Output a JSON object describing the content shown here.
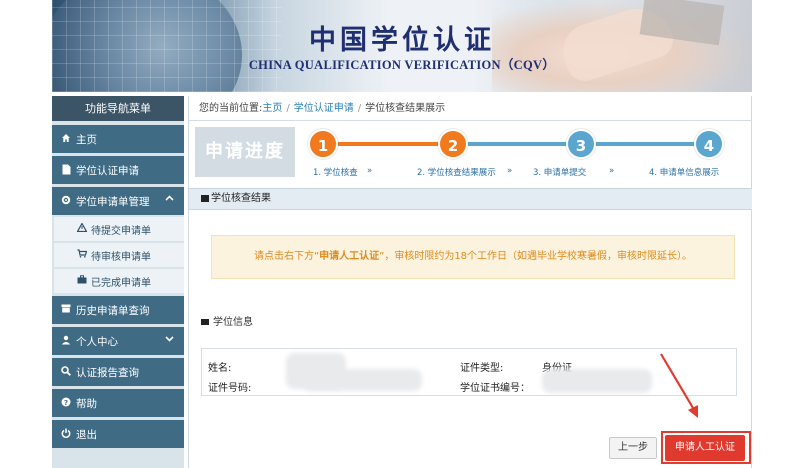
{
  "banner": {
    "title_zh": "中国学位认证",
    "title_en": "CHINA QUALIFICATION VERIFICATION（CQV）"
  },
  "sidebar": {
    "header": "功能导航菜单",
    "items": [
      {
        "label": "主页",
        "icon": "home-icon"
      },
      {
        "label": "学位认证申请",
        "icon": "document-icon"
      },
      {
        "label": "学位申请单管理",
        "icon": "gear-icon"
      },
      {
        "label": "待提交申请单",
        "icon": "warning-icon"
      },
      {
        "label": "待审核申请单",
        "icon": "cart-icon"
      },
      {
        "label": "已完成申请单",
        "icon": "briefcase-icon"
      },
      {
        "label": "历史申请单查询",
        "icon": "archive-icon"
      },
      {
        "label": "个人中心",
        "icon": "user-icon"
      },
      {
        "label": "认证报告查询",
        "icon": "search-icon"
      },
      {
        "label": "帮助",
        "icon": "help-icon"
      },
      {
        "label": "退出",
        "icon": "power-icon"
      }
    ]
  },
  "breadcrumb": {
    "prefix": "您的当前位置:",
    "home": "主页",
    "apply": "学位认证申请",
    "current": "学位核查结果展示"
  },
  "progress": {
    "title": "申请进度",
    "steps": [
      {
        "num": "1",
        "label": "1. 学位核查"
      },
      {
        "num": "2",
        "label": "2. 学位核查结果展示"
      },
      {
        "num": "3",
        "label": "3. 申请单提交"
      },
      {
        "num": "4",
        "label": "4. 申请单信息展示"
      }
    ],
    "arrow": "»",
    "colors": {
      "done": "#f07a1d",
      "pending": "#5aa6cf"
    }
  },
  "result": {
    "section_title": "学位核查结果",
    "notice_before": "请点击右下方“",
    "notice_highlight": "申请人工认证",
    "notice_after": "”，审核时限约为18个工作日（如遇毕业学校寒暑假，审核时限延长）。"
  },
  "degree_info": {
    "title": "学位信息",
    "name_label": "姓名:",
    "id_label": "证件号码:",
    "id_type_label": "证件类型:",
    "id_type_value": "身份证",
    "cert_no_label": "学位证书编号："
  },
  "buttons": {
    "prev": "上一步",
    "apply": "申请人工认证"
  },
  "colors": {
    "sidebar_item": "#3f6b85",
    "accent_red": "#e03a2f",
    "notice_text": "#e08a1e"
  }
}
